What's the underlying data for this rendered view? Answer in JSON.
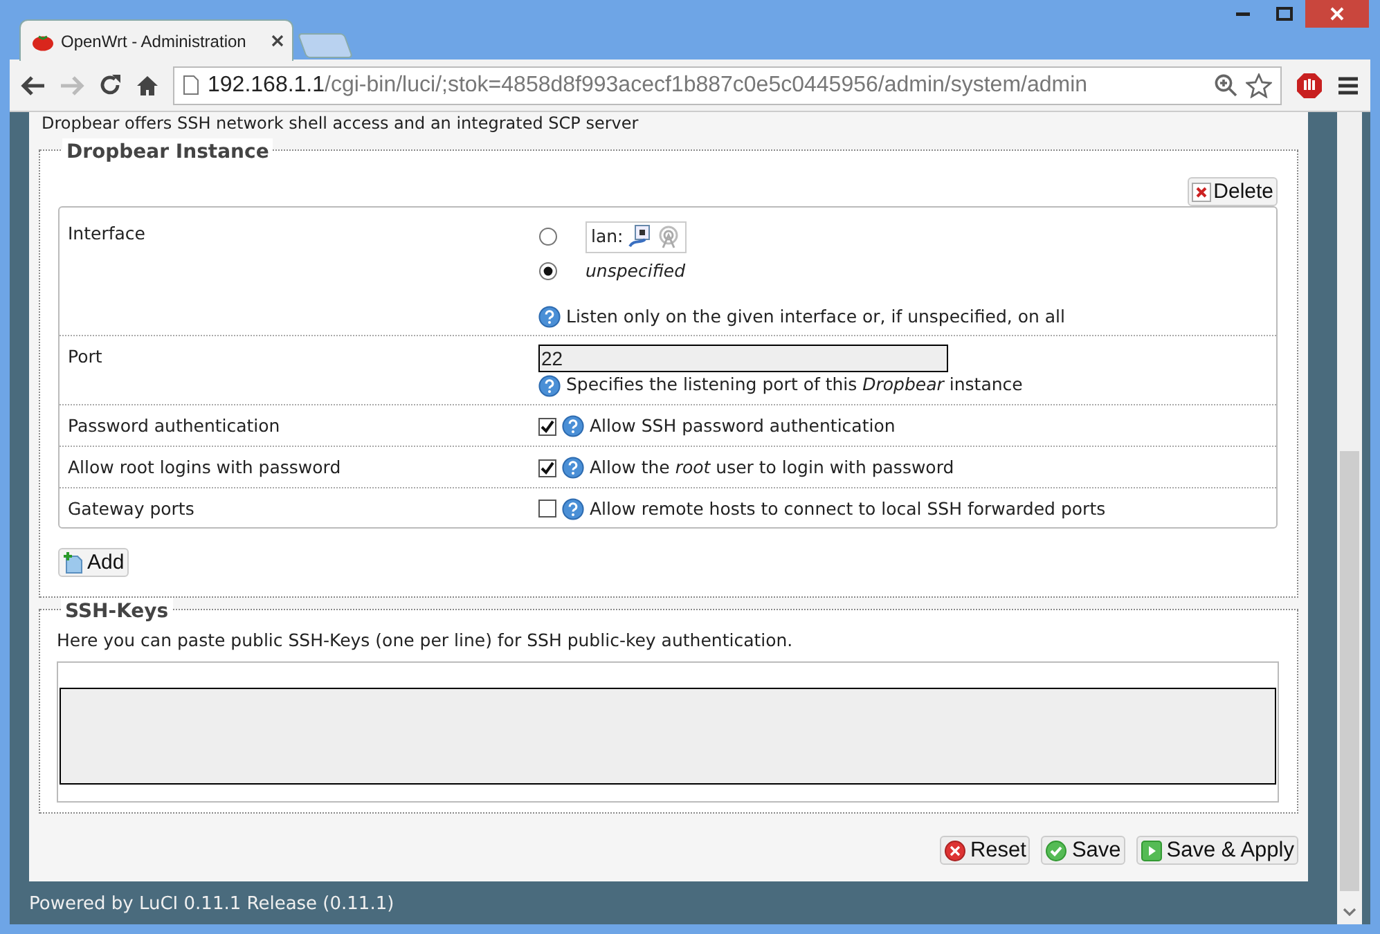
{
  "browser": {
    "tab": {
      "title": "OpenWrt - Administration"
    },
    "url": {
      "host": "192.168.1.1",
      "path": "/cgi-bin/luci/;stok=4858d8f993acecf1b887c0e5c0445956/admin/system/admin"
    }
  },
  "intro": "Dropbear offers SSH network shell access and an integrated SCP server",
  "instance": {
    "legend": "Dropbear Instance",
    "delete": "Delete",
    "add": "Add",
    "fields": [
      {
        "kind": "radio",
        "label": "Interface",
        "options": [
          {
            "kind": "network",
            "label": "lan:",
            "selected": false
          },
          {
            "kind": "plain",
            "label": "unspecified",
            "selected": true
          }
        ],
        "help": "Listen only on the given interface or, if unspecified, on all"
      },
      {
        "kind": "text",
        "label": "Port",
        "value": "22",
        "help": "Specifies the listening port of this *Dropbear* instance"
      },
      {
        "kind": "checkbox",
        "label": "Password authentication",
        "checked": true,
        "help": "Allow SSH password authentication"
      },
      {
        "kind": "checkbox",
        "label": "Allow root logins with password",
        "checked": true,
        "help": "Allow the *root* user to login with password"
      },
      {
        "kind": "checkbox",
        "label": "Gateway ports",
        "checked": false,
        "help": "Allow remote hosts to connect to local SSH forwarded ports"
      }
    ]
  },
  "ssh_keys": {
    "legend": "SSH-Keys",
    "description": "Here you can paste public SSH-Keys (one per line) for SSH public-key authentication."
  },
  "buttons": [
    {
      "kind": "reset",
      "label": "Reset"
    },
    {
      "kind": "save",
      "label": "Save"
    },
    {
      "kind": "apply",
      "label": "Save & Apply"
    }
  ],
  "footer": "Powered by LuCI 0.11.1 Release (0.11.1)"
}
